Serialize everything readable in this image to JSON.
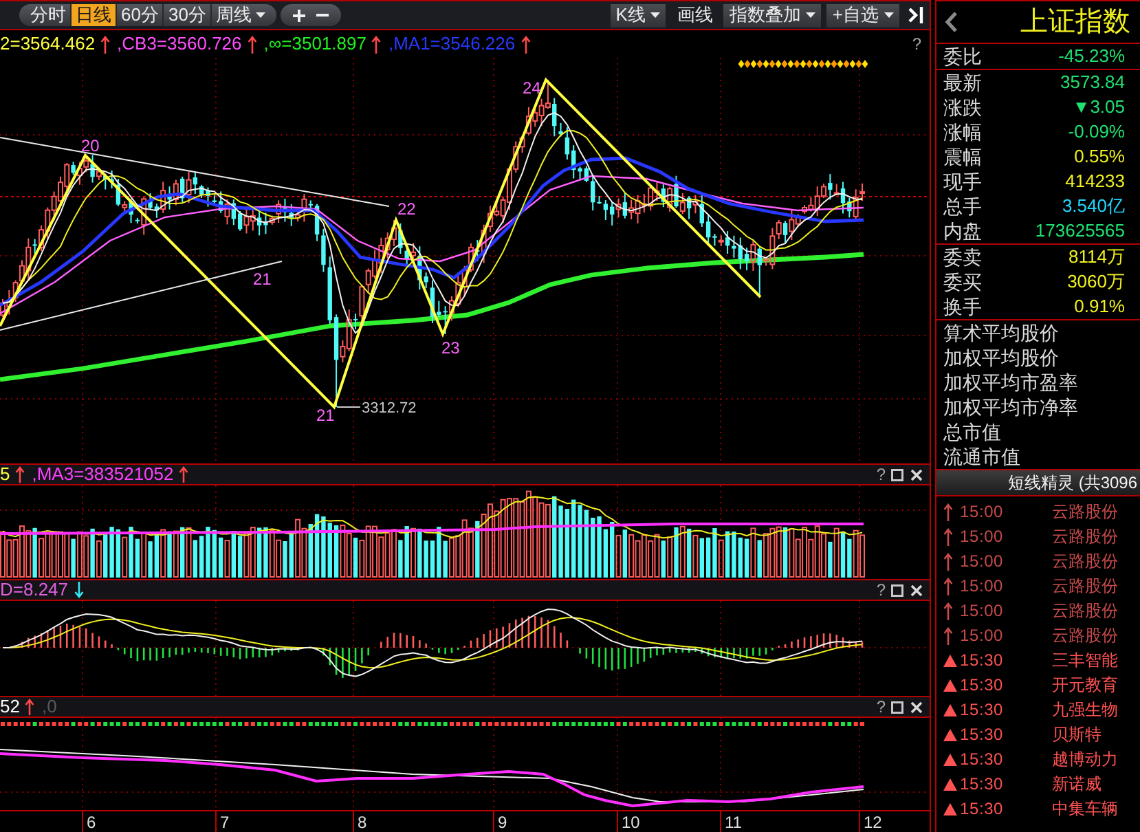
{
  "toolbar": {
    "period_tabs": [
      {
        "label": "分时",
        "selected": false,
        "dropdown": false
      },
      {
        "label": "日线",
        "selected": true,
        "dropdown": false
      },
      {
        "label": "60分",
        "selected": false,
        "dropdown": false
      },
      {
        "label": "30分",
        "selected": false,
        "dropdown": false
      },
      {
        "label": "周线",
        "selected": false,
        "dropdown": true
      }
    ],
    "tools": [
      {
        "label": "K线",
        "dropdown": true
      },
      {
        "label": "画线",
        "dropdown": false
      },
      {
        "label": "指数叠加",
        "dropdown": true
      },
      {
        "label": "+自选",
        "dropdown": true
      }
    ]
  },
  "price_panel": {
    "legend": [
      {
        "text": "2=3564.462",
        "color": "#ffff40",
        "kind": "rising"
      },
      {
        "text": ",CB3=3560.726",
        "color": "#ff50ff",
        "kind": "rising"
      },
      {
        "text": ",∞=3501.897",
        "color": "#20f020",
        "kind": "rising"
      },
      {
        "text": ",MA1=3546.226",
        "color": "#2838ff",
        "kind": "rising"
      }
    ],
    "help": "?",
    "wave_labels": [
      "20",
      "21",
      "22",
      "23",
      "24",
      "21"
    ],
    "low_label": "3312.72"
  },
  "volume_panel": {
    "legend": [
      {
        "text": "5",
        "color": "#ffff40",
        "kind": "rising"
      },
      {
        "text": ",MA3=383521052",
        "color": "#ff40ff",
        "kind": "rising"
      }
    ],
    "help": "?"
  },
  "macd_panel": {
    "legend": [
      {
        "text": "D=8.247",
        "color": "#e060e0",
        "kind": "falling"
      }
    ],
    "help": "?"
  },
  "lower_panel": {
    "legend": [
      {
        "text": "52",
        "color": "#ffffff",
        "kind": "rising"
      },
      {
        "text": ",0",
        "color": "#5a5a5a",
        "kind": "plain"
      }
    ],
    "help": "?"
  },
  "x_axis": {
    "labels": [
      "6",
      "7",
      "8",
      "9",
      "10",
      "11",
      "12"
    ]
  },
  "quote": {
    "title": "上证指数",
    "sections": [
      {
        "rows": [
          {
            "label": "委比",
            "value": "-45.23%",
            "color": "#20e070"
          }
        ]
      },
      {
        "rows": [
          {
            "label": "最新",
            "value": "3573.84",
            "color": "#20e070"
          },
          {
            "label": "涨跌",
            "value": "▼3.05",
            "color": "#20e070"
          },
          {
            "label": "涨幅",
            "value": "-0.09%",
            "color": "#20e070"
          },
          {
            "label": "震幅",
            "value": "0.55%",
            "color": "#f0f020"
          },
          {
            "label": "现手",
            "value": "414233",
            "color": "#f0f020"
          },
          {
            "label": "总手",
            "value": "3.540亿",
            "color": "#20d8ff"
          },
          {
            "label": "内盘",
            "value": "173625565",
            "color": "#20e070"
          }
        ]
      },
      {
        "rows": [
          {
            "label": "委卖",
            "value": "8114万",
            "color": "#f0f020"
          },
          {
            "label": "委买",
            "value": "3060万",
            "color": "#f0f020"
          },
          {
            "label": "换手",
            "value": "0.91%",
            "color": "#f0f020"
          }
        ]
      },
      {
        "rows": [
          {
            "label": "算术平均股价"
          },
          {
            "label": "加权平均股价"
          },
          {
            "label": "加权平均市盈率"
          },
          {
            "label": "加权平均市净率"
          },
          {
            "label": "总市值"
          },
          {
            "label": "流通市值"
          }
        ]
      }
    ]
  },
  "signals": {
    "title": "短线精灵 (共3096",
    "items": [
      {
        "kind": "arrow",
        "time": "15:00",
        "name": "云路股份"
      },
      {
        "kind": "arrow",
        "time": "15:00",
        "name": "云路股份"
      },
      {
        "kind": "arrow",
        "time": "15:00",
        "name": "云路股份"
      },
      {
        "kind": "arrow",
        "time": "15:00",
        "name": "云路股份"
      },
      {
        "kind": "arrow",
        "time": "15:00",
        "name": "云路股份"
      },
      {
        "kind": "arrow",
        "time": "15:00",
        "name": "云路股份"
      },
      {
        "kind": "triangle",
        "time": "15:30",
        "name": "三丰智能"
      },
      {
        "kind": "triangle",
        "time": "15:30",
        "name": "开元教育"
      },
      {
        "kind": "triangle",
        "time": "15:30",
        "name": "九强生物"
      },
      {
        "kind": "triangle",
        "time": "15:30",
        "name": "贝斯特"
      },
      {
        "kind": "triangle",
        "time": "15:30",
        "name": "越博动力"
      },
      {
        "kind": "triangle",
        "time": "15:30",
        "name": "新诺威"
      },
      {
        "kind": "triangle",
        "time": "15:30",
        "name": "中集车辆"
      }
    ]
  }
}
